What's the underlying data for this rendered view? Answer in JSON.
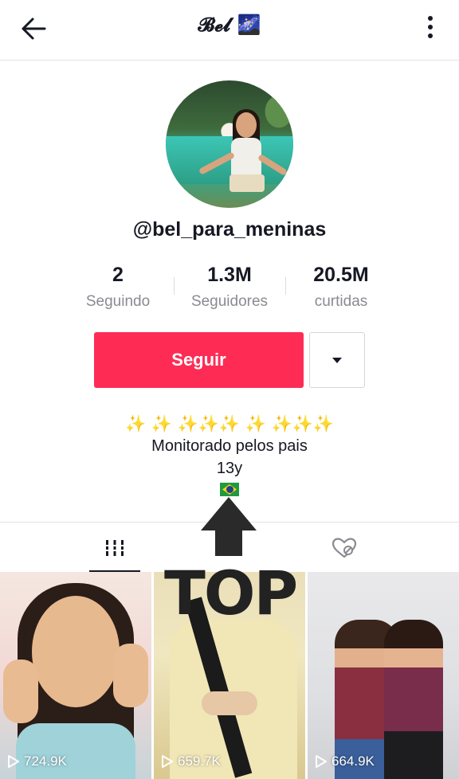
{
  "header": {
    "title": "𝓑𝓮𝓵 🌌",
    "back_icon": "arrow-left-icon",
    "more_icon": "more-vertical-icon"
  },
  "profile": {
    "username": "@bel_para_meninas",
    "stats": [
      {
        "value": "2",
        "label": "Seguindo"
      },
      {
        "value": "1.3M",
        "label": "Seguidores"
      },
      {
        "value": "20.5M",
        "label": "curtidas"
      }
    ],
    "follow_label": "Seguir",
    "bio": {
      "line1": "✨ ✨ ✨✨✨ ✨ ✨✨✨",
      "line2": "Monitorado pelos pais",
      "line3": "13y"
    }
  },
  "overlay": {
    "annotation_text": "TOP"
  },
  "tabs": [
    {
      "icon": "grid-videos-icon",
      "active": true
    },
    {
      "icon": "liked-hidden-icon",
      "active": false
    }
  ],
  "videos": [
    {
      "plays": "724.9K"
    },
    {
      "plays": "659.7K"
    },
    {
      "plays": "664.9K"
    }
  ],
  "colors": {
    "accent": "#fe2c55",
    "text": "#161823",
    "muted": "#8a8b91"
  }
}
